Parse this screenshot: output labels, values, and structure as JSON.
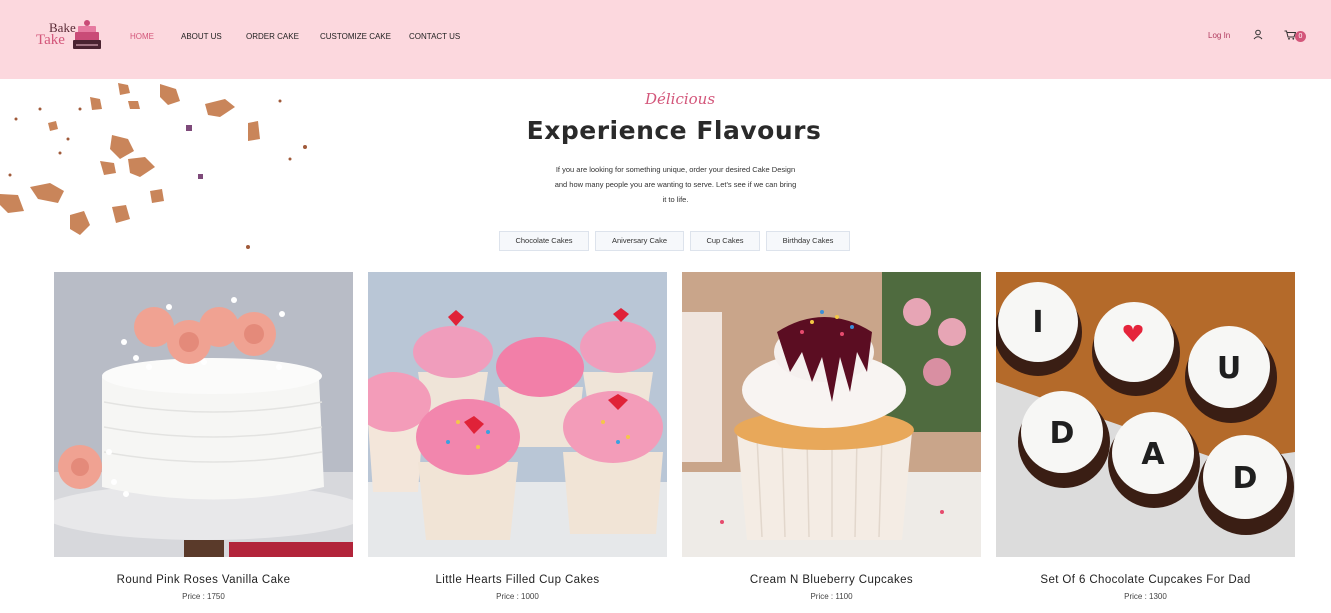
{
  "brand": {
    "line1": "Bake",
    "line2": "Take"
  },
  "nav": [
    {
      "label": "HOME",
      "active": true
    },
    {
      "label": "ABOUT US"
    },
    {
      "label": "ORDER CAKE"
    },
    {
      "label": "CUSTOMIZE CAKE"
    },
    {
      "label": "CONTACT US"
    }
  ],
  "header_right": {
    "login": "Log In",
    "cart_count": "0"
  },
  "hero": {
    "script": "Délicious",
    "title": "Experience Flavours",
    "description": "If you are looking for something unique, order your desired Cake Design and how many people you are wanting to serve. Let's see if we can bring it to life."
  },
  "tabs": [
    "Chocolate Cakes",
    "Aniversary Cake",
    "Cup Cakes",
    "Birthday Cakes"
  ],
  "products": [
    {
      "name": "Round Pink Roses Vanilla Cake",
      "price": "Price : 1750"
    },
    {
      "name": "Little Hearts Filled Cup Cakes",
      "price": "Price : 1000"
    },
    {
      "name": "Cream N Blueberry Cupcakes",
      "price": "Price : 1100"
    },
    {
      "name": "Set Of 6 Chocolate Cupcakes For Dad",
      "price": "Price : 1300"
    }
  ],
  "cupcake_letters": [
    "I",
    "U",
    "D",
    "A",
    "D"
  ],
  "colors": {
    "header_bg": "#fcd8de",
    "accent": "#d3567a"
  }
}
